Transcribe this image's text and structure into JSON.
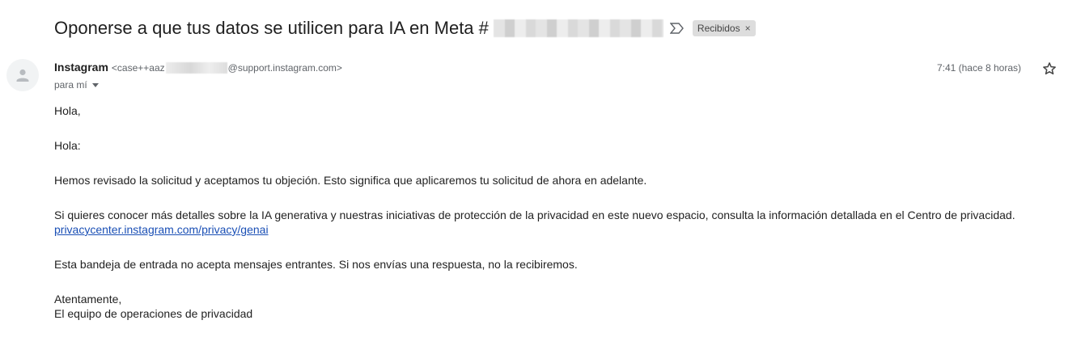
{
  "email": {
    "subject": "Oponerse a que tus datos se utilicen para IA en Meta #",
    "label": "Recibidos",
    "label_remove": "×",
    "sender": {
      "name": "Instagram",
      "email_prefix": "<case++aaz",
      "email_suffix": "@support.instagram.com>"
    },
    "recipient": "para mí",
    "timestamp": "7:41 (hace 8 horas)",
    "icons": {
      "avatar": "person-avatar-icon",
      "importance": "importance-marker-icon",
      "star": "star-icon",
      "dropdown": "chevron-down-icon"
    },
    "body": {
      "greeting_1": "Hola,",
      "greeting_2": "Hola:",
      "paragraph_1": "Hemos revisado la solicitud y aceptamos tu objeción. Esto significa que aplicaremos tu solicitud de ahora en adelante.",
      "paragraph_2": "Si quieres conocer más detalles sobre la IA generativa y nuestras iniciativas de protección de la privacidad en este nuevo espacio, consulta la información detallada en el Centro de privacidad.",
      "link": "privacycenter.instagram.com/privacy/genai",
      "paragraph_3": "Esta bandeja de entrada no acepta mensajes entrantes. Si nos envías una respuesta, no la recibiremos.",
      "closing": "Atentamente,",
      "signature": "El equipo de operaciones de privacidad"
    }
  },
  "colors": {
    "link": "#1a4fb5",
    "label_chip_bg": "#dddddd",
    "muted_text": "#5f6368"
  }
}
